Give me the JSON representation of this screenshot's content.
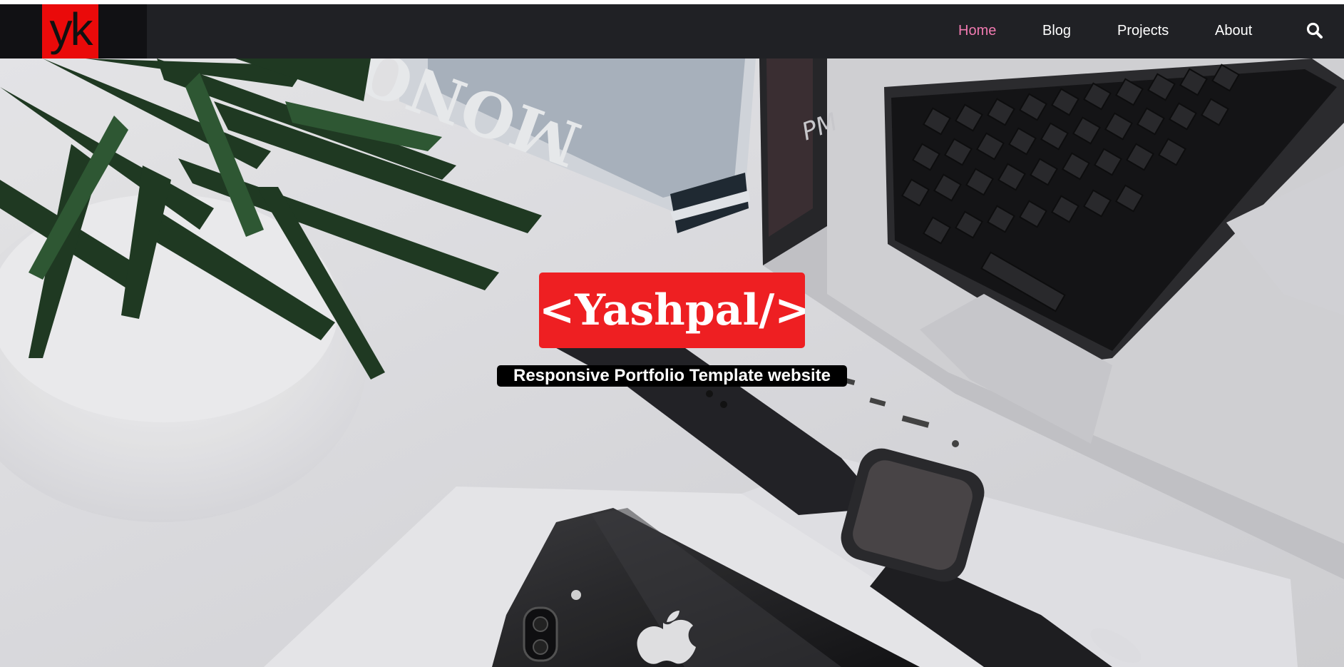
{
  "brand": {
    "logo_text": "yk",
    "logo_color": "#ea0a0a"
  },
  "nav": {
    "items": [
      {
        "label": "Home",
        "active": true
      },
      {
        "label": "Blog",
        "active": false
      },
      {
        "label": "Projects",
        "active": false
      },
      {
        "label": "About",
        "active": false
      }
    ],
    "search_icon": "search-icon",
    "active_color": "#f07ab0",
    "background": "#202125"
  },
  "hero": {
    "title": "<Yashpal/>",
    "subtitle": "Responsive Portfolio Template website",
    "title_bg": "#ee1f22",
    "subtitle_bg": "#000000",
    "magazine_text": "MONO"
  }
}
